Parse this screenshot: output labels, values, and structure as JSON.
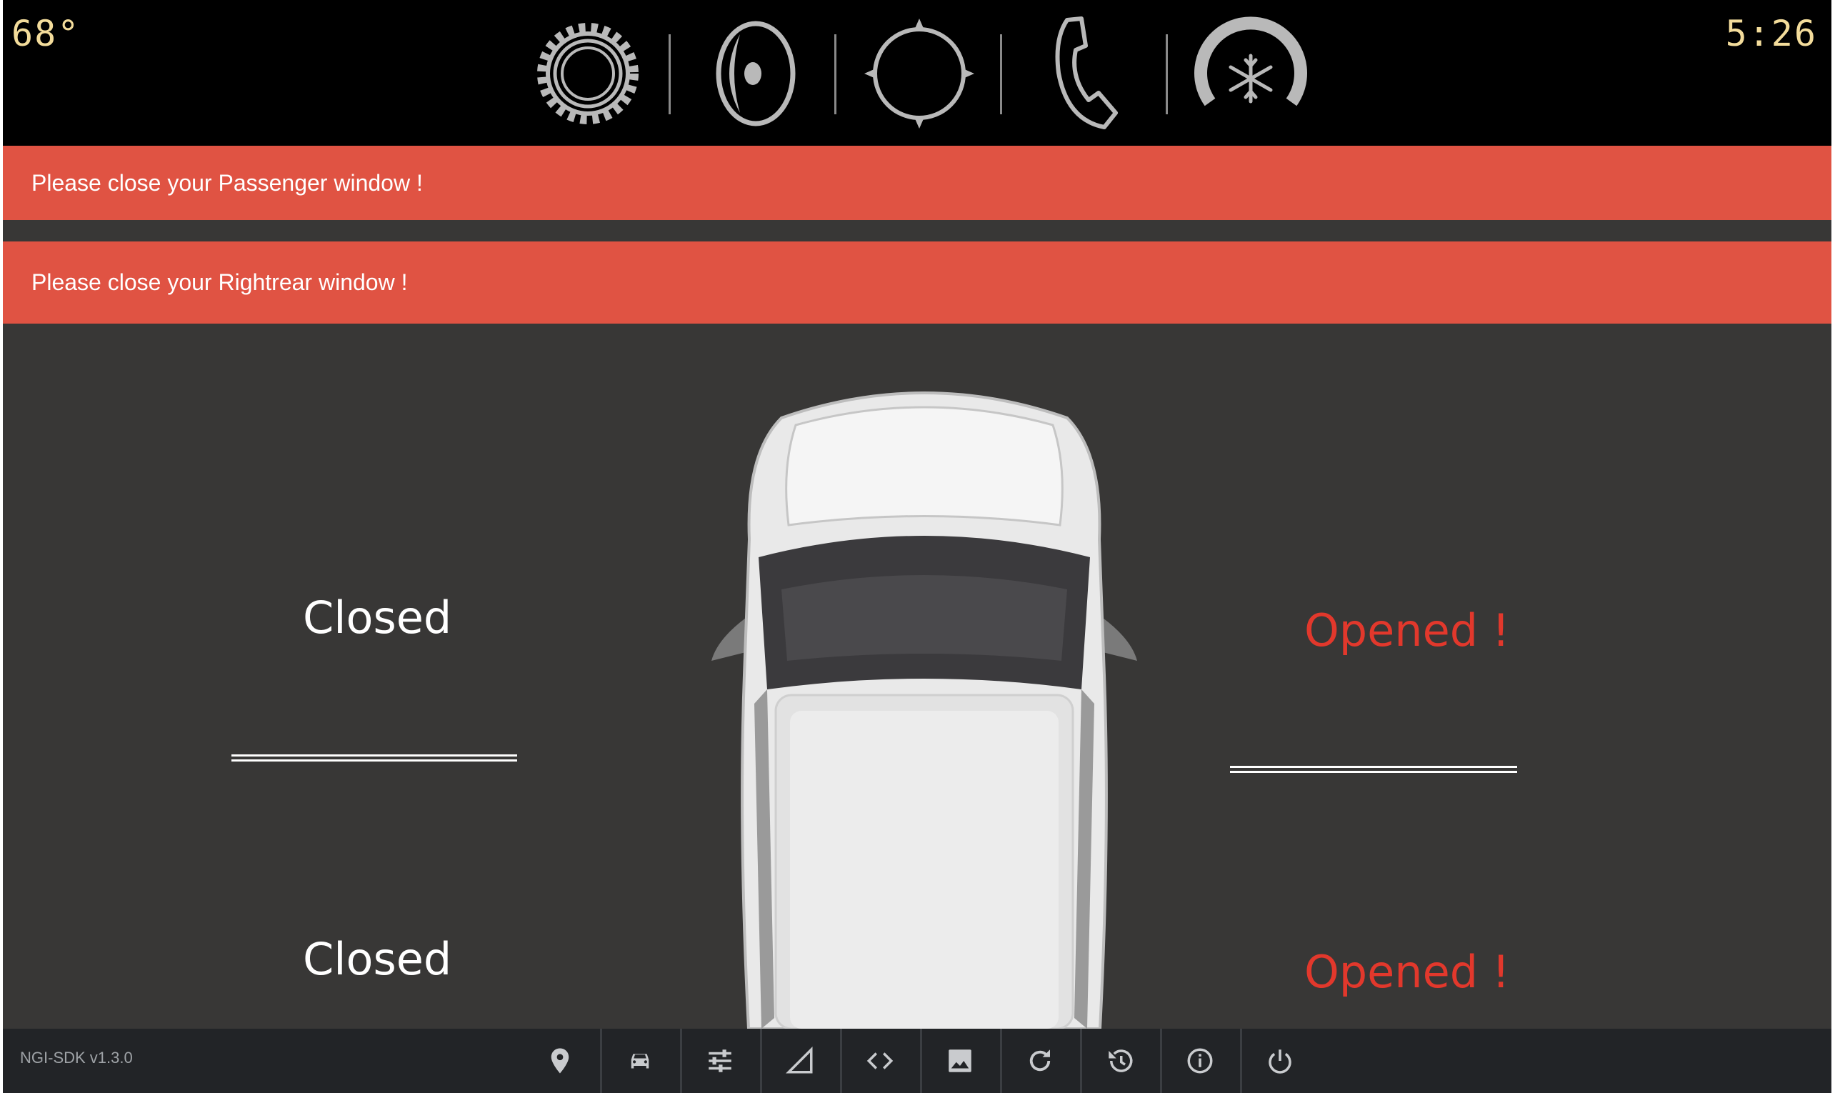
{
  "header": {
    "temperature": "68°",
    "clock": "5:26",
    "icons": [
      "settings-gear-icon",
      "audio-speaker-icon",
      "navigation-compass-icon",
      "phone-icon",
      "climate-fan-icon"
    ]
  },
  "alerts": [
    {
      "text": "Please close your Passenger window !"
    },
    {
      "text": "Please close your Rightrear window !"
    }
  ],
  "windows": {
    "driver": {
      "status": "Closed",
      "color": "#ffffff"
    },
    "passenger": {
      "status": "Opened !",
      "color": "#e2382c"
    },
    "leftrear": {
      "status": "Closed",
      "color": "#ffffff"
    },
    "rightrear": {
      "status": "Opened !",
      "color": "#e2382c"
    }
  },
  "footer": {
    "version": "NGI-SDK v1.3.0",
    "buttons": [
      "location-pin-icon",
      "car-icon",
      "sliders-icon",
      "signal-icon",
      "code-icon",
      "image-icon",
      "refresh-icon",
      "history-icon",
      "info-icon",
      "power-icon"
    ]
  },
  "colors": {
    "alert": "#e05343",
    "header_text": "#f3dc9b",
    "background": "#383736"
  }
}
